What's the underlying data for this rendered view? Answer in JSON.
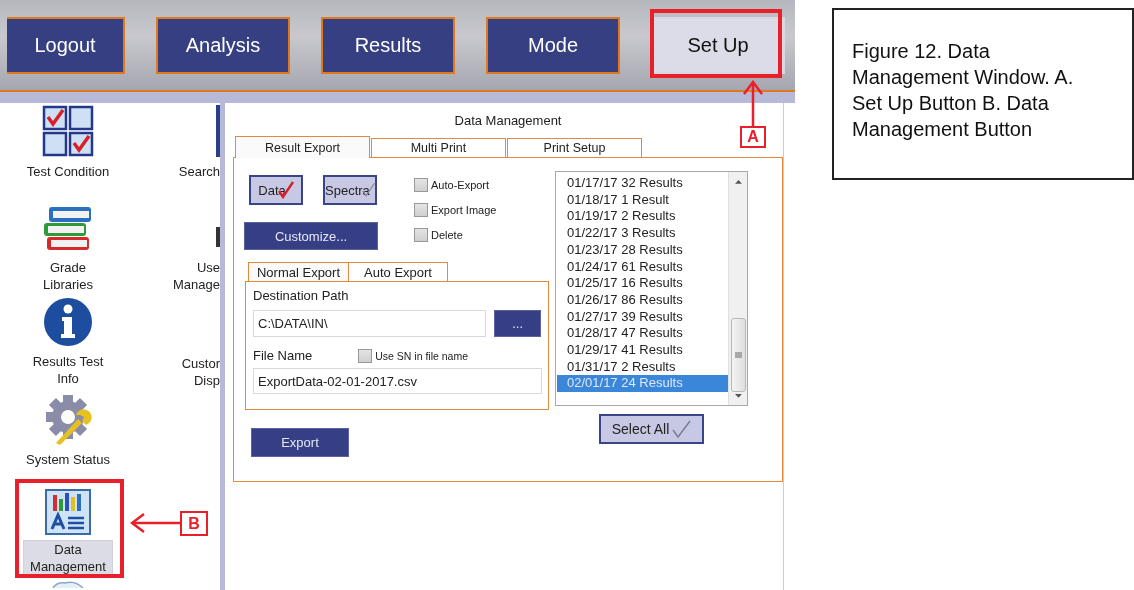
{
  "top_nav": [
    {
      "label": "Logout",
      "selected": false
    },
    {
      "label": "Analysis",
      "selected": false
    },
    {
      "label": "Results",
      "selected": false
    },
    {
      "label": "Mode",
      "selected": false
    },
    {
      "label": "Set Up",
      "selected": true
    }
  ],
  "sidebar": {
    "columns": [
      {
        "items": [
          {
            "kind": "checkboxes",
            "label_lines": [
              "Test Condition"
            ],
            "selected": false
          },
          {
            "kind": "books",
            "label_lines": [
              "Grade",
              "Libraries"
            ],
            "selected": false
          },
          {
            "kind": "info",
            "label_lines": [
              "Results Test",
              "Info"
            ],
            "selected": false
          },
          {
            "kind": "gear",
            "label_lines": [
              "System Status"
            ],
            "selected": false
          },
          {
            "kind": "chart",
            "label_lines": [
              "Data",
              "Management"
            ],
            "selected": true
          },
          {
            "kind": "cloud",
            "selected": false
          }
        ]
      },
      {
        "items": [
          {
            "kind": "sliver",
            "label_lines": [
              "Search"
            ],
            "selected": false
          },
          {
            "kind": "sliver-dark",
            "label_lines": [
              "Use",
              "Manage"
            ],
            "selected": false
          },
          {
            "kind": "none",
            "label_lines": [
              "Custor",
              "Disp"
            ],
            "selected": false
          }
        ]
      }
    ]
  },
  "dialog": {
    "title": "Data Management",
    "tabs": [
      {
        "label": "Result Export",
        "selected": true
      },
      {
        "label": "Multi Print",
        "selected": false
      },
      {
        "label": "Print Setup",
        "selected": false
      }
    ],
    "export_type_buttons": [
      {
        "label": "Data",
        "checked": true
      },
      {
        "label": "Spectra",
        "checked": false
      }
    ],
    "customize_button": "Customize...",
    "options": [
      {
        "label": "Auto-Export",
        "checked": false
      },
      {
        "label": "Export Image",
        "checked": false
      },
      {
        "label": "Delete",
        "checked": false
      }
    ],
    "subtabs": [
      {
        "label": "Normal Export",
        "selected": true
      },
      {
        "label": "Auto Export",
        "selected": false
      }
    ],
    "destination_path": {
      "label": "Destination Path",
      "value": "C:\\DATA\\IN\\"
    },
    "browse_button": "...",
    "file_name": {
      "label": "File Name",
      "value": "ExportData-02-01-2017.csv"
    },
    "use_sn_option": {
      "label": "Use SN in file name",
      "checked": false
    },
    "export_button": "Export",
    "results_list": {
      "items": [
        {
          "text": "01/17/17 32 Results",
          "selected": false
        },
        {
          "text": "01/18/17 1 Result",
          "selected": false
        },
        {
          "text": "01/19/17 2 Results",
          "selected": false
        },
        {
          "text": "01/22/17 3 Results",
          "selected": false
        },
        {
          "text": "01/23/17 28 Results",
          "selected": false
        },
        {
          "text": "01/24/17 61 Results",
          "selected": false
        },
        {
          "text": "01/25/17 16 Results",
          "selected": false
        },
        {
          "text": "01/26/17 86 Results",
          "selected": false
        },
        {
          "text": "01/27/17 39 Results",
          "selected": false
        },
        {
          "text": "01/28/17 47 Results",
          "selected": false
        },
        {
          "text": "01/29/17 41 Results",
          "selected": false
        },
        {
          "text": "01/31/17 2 Results",
          "selected": false
        },
        {
          "text": "02/01/17 24 Results",
          "selected": true
        }
      ]
    },
    "select_all_button": "Select All"
  },
  "callouts": [
    {
      "label": "A"
    },
    {
      "label": "B"
    }
  ],
  "caption": "Figure 12. Data Management Window. A. Set Up Button B. Data Management Button"
}
